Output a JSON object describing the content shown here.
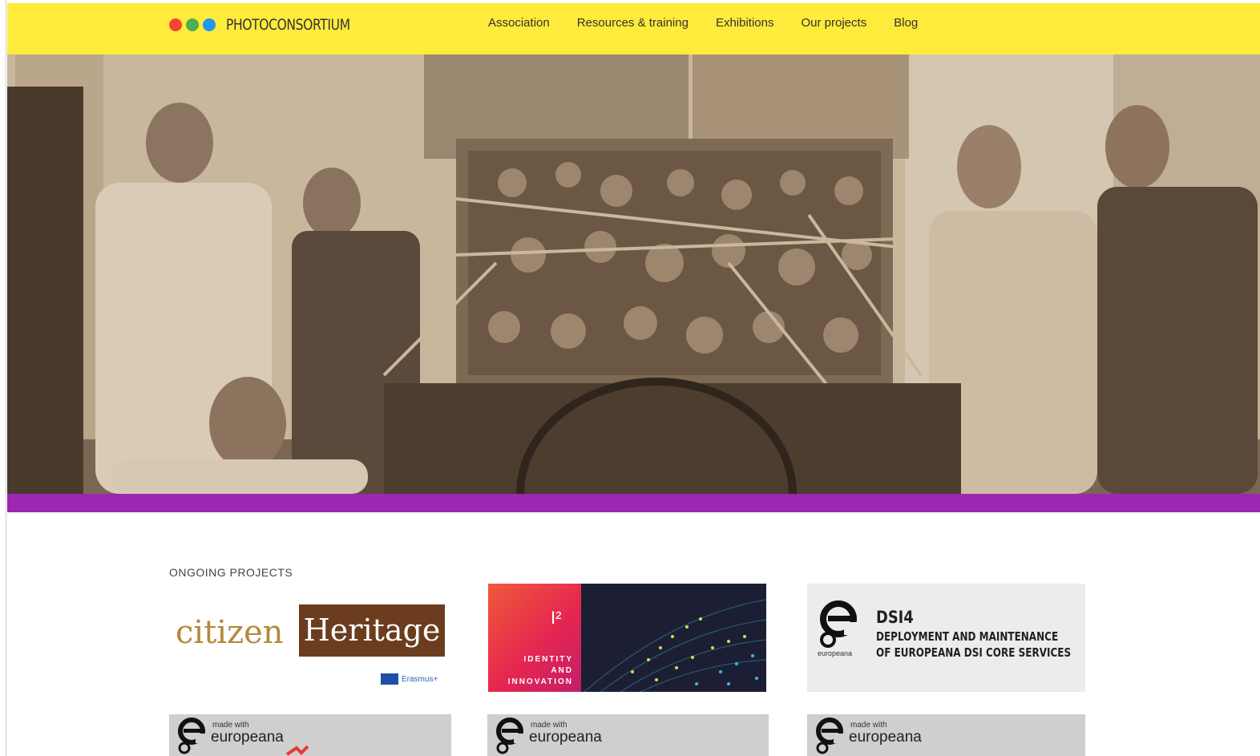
{
  "header": {
    "logo_text": "PHOTOCONSORTIUM",
    "logo_dot_colors": [
      "#f44336",
      "#4caf50",
      "#2196f3"
    ],
    "nav": [
      {
        "label": "Association"
      },
      {
        "label": "Resources & training"
      },
      {
        "label": "Exhibitions"
      },
      {
        "label": "Our projects"
      },
      {
        "label": "Blog"
      }
    ],
    "background_color": "#ffeb3b"
  },
  "hero": {
    "image": "sepia-archive-photo-workers-with-sculpted-relief-on-cart",
    "band_color": "#9c27b0"
  },
  "ongoing": {
    "label": "ONGOING PROJECTS",
    "cards": [
      {
        "citizen": "citizen",
        "heritage": "Heritage",
        "funder": "Erasmus+"
      },
      {
        "mark": "I²",
        "lines": [
          "IDENTITY",
          "AND",
          "INNOVATION"
        ]
      },
      {
        "logo_label": "europeana",
        "title": "DSI4",
        "subtitle_1": "DEPLOYMENT AND MAINTENANCE",
        "subtitle_2": "OF EUROPEANA DSI CORE SERVICES"
      }
    ],
    "made_with": [
      {
        "small": "made with",
        "big": "europeana"
      },
      {
        "small": "made with",
        "big": "europeana"
      },
      {
        "small": "made with",
        "big": "europeana"
      }
    ]
  }
}
